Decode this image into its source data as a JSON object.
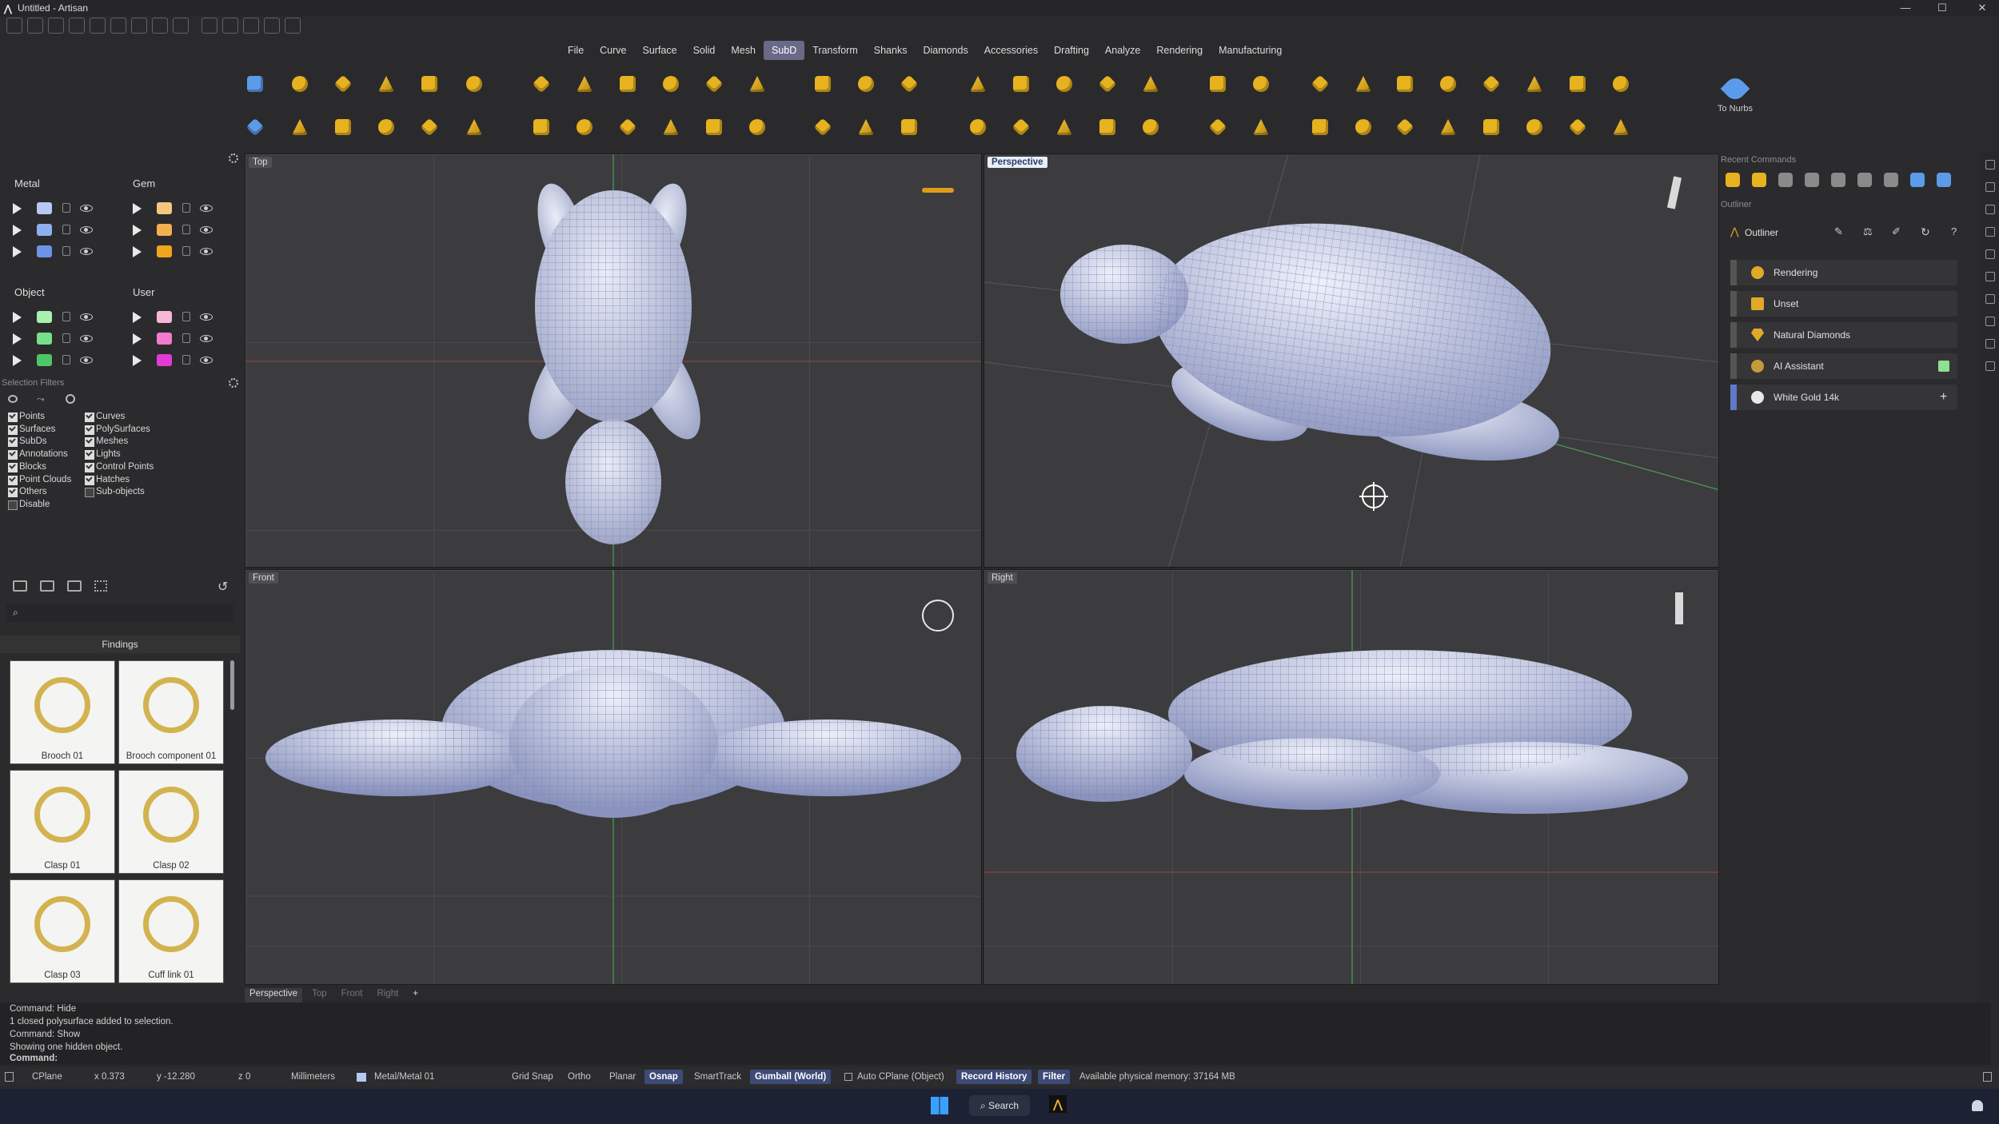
{
  "window": {
    "title": "Untitled - Artisan",
    "minimize": "—",
    "maximize": "☐",
    "close": "✕"
  },
  "menu": {
    "items": [
      "File",
      "Curve",
      "Surface",
      "Solid",
      "Mesh",
      "SubD",
      "Transform",
      "Shanks",
      "Diamonds",
      "Accessories",
      "Drafting",
      "Analyze",
      "Rendering",
      "Manufacturing"
    ],
    "active": "SubD"
  },
  "toolbar": {
    "to_nurbs_label": "To Nurbs"
  },
  "layers": {
    "metal": {
      "title": "Metal",
      "swatches": [
        "#b6c8f3",
        "#8fb0f0",
        "#6e93e6"
      ]
    },
    "gem": {
      "title": "Gem",
      "swatches": [
        "#f5c680",
        "#f2b04f",
        "#f0a51f"
      ]
    },
    "object": {
      "title": "Object",
      "swatches": [
        "#a9f0b0",
        "#77e08a",
        "#4cc765"
      ]
    },
    "user": {
      "title": "User",
      "swatches": [
        "#f7b8d8",
        "#f27ad0",
        "#e43bd6"
      ]
    }
  },
  "selection_filters": {
    "title": "Selection Filters",
    "col1": [
      {
        "label": "Points",
        "on": true
      },
      {
        "label": "Surfaces",
        "on": true
      },
      {
        "label": "SubDs",
        "on": true
      },
      {
        "label": "Annotations",
        "on": true
      },
      {
        "label": "Blocks",
        "on": true
      },
      {
        "label": "Point Clouds",
        "on": true
      },
      {
        "label": "Others",
        "on": true
      },
      {
        "label": "Disable",
        "on": false
      }
    ],
    "col2": [
      {
        "label": "Curves",
        "on": true
      },
      {
        "label": "PolySurfaces",
        "on": true
      },
      {
        "label": "Meshes",
        "on": true
      },
      {
        "label": "Lights",
        "on": true
      },
      {
        "label": "Control Points",
        "on": true
      },
      {
        "label": "Hatches",
        "on": true
      },
      {
        "label": "Sub-objects",
        "on": false
      }
    ]
  },
  "library": {
    "category": "Findings",
    "items": [
      "Brooch 01",
      "Brooch component 01",
      "Clasp 01",
      "Clasp 02",
      "Clasp 03",
      "Cuff link 01"
    ]
  },
  "viewports": {
    "top": "Top",
    "perspective": "Perspective",
    "front": "Front",
    "right": "Right"
  },
  "view_tabs": [
    "Perspective",
    "Top",
    "Front",
    "Right",
    "+"
  ],
  "right_panel": {
    "recent_title": "Recent Commands",
    "outliner_section": "Outliner",
    "outliner_title": "Outliner",
    "items": [
      "Rendering",
      "Unset",
      "Natural Diamonds",
      "AI Assistant",
      "White Gold 14k"
    ]
  },
  "command": {
    "history": [
      "Command: Hide",
      "1 closed polysurface added to selection.",
      "Command: Show",
      "Showing one hidden object."
    ],
    "prompt": "Command:"
  },
  "status": {
    "cplane": "CPlane",
    "x": "x 0.373",
    "y": "y -12.280",
    "z": "z 0",
    "units": "Millimeters",
    "layer": "Metal/Metal 01",
    "grid_snap": "Grid Snap",
    "ortho": "Ortho",
    "planar": "Planar",
    "osnap": "Osnap",
    "smarttrack": "SmartTrack",
    "gumball": "Gumball (World)",
    "auto_cplane": "Auto CPlane (Object)",
    "record_history": "Record History",
    "filter": "Filter",
    "memory": "Available physical memory: 37164 MB"
  },
  "taskbar": {
    "search": "Search"
  }
}
